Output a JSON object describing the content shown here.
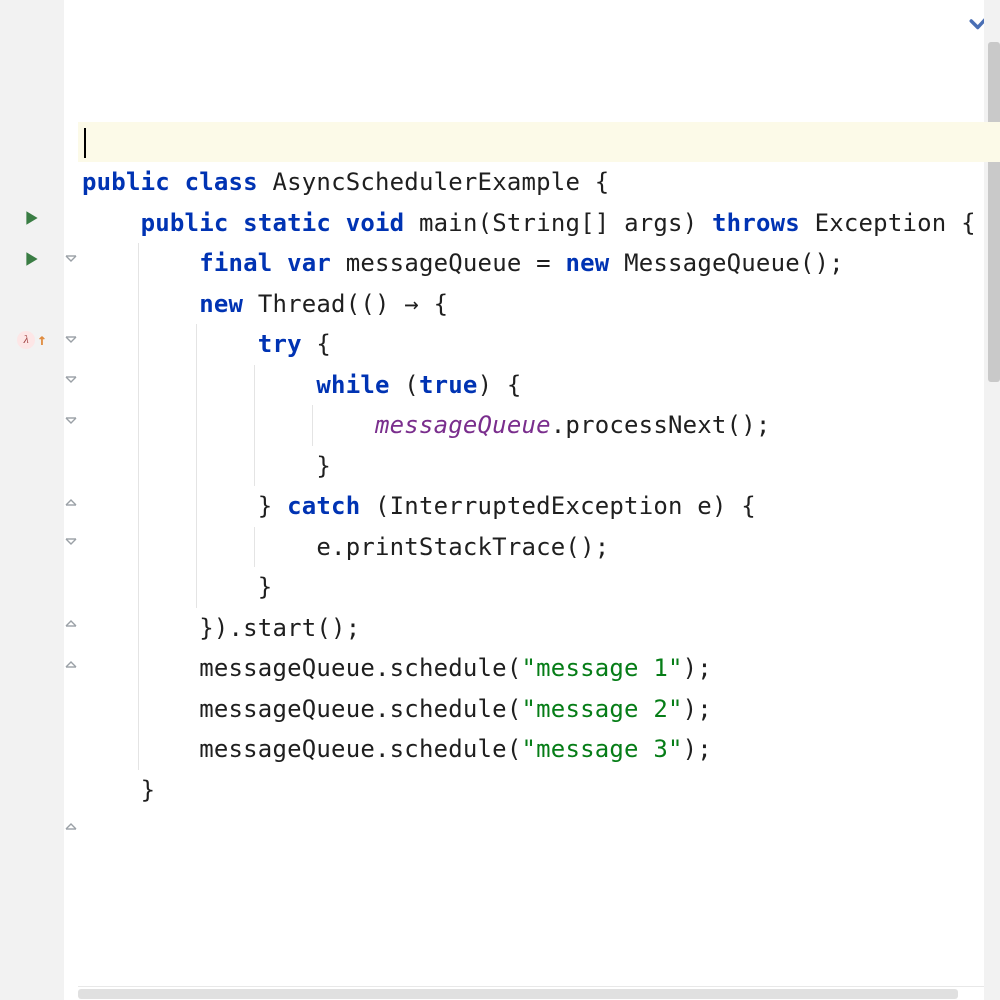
{
  "colors": {
    "keyword": "#0033B3",
    "string": "#067D17",
    "variable": "#7A2E8D",
    "highlight": "#fcfae8",
    "gutter": "#f2f2f2",
    "run": "#3a7d44",
    "fold": "#9aa0a6",
    "check": "#4a6fb5"
  },
  "code": {
    "line5": {
      "public": "public",
      "class": "class",
      "className": "AsyncSchedulerExample",
      "brace": "{"
    },
    "line6": {
      "public": "public",
      "static": "static",
      "void": "void",
      "method": "main",
      "params": "(String[] args)",
      "throws": "throws",
      "exc": "Exception",
      "brace": "{"
    },
    "line7": {
      "final": "final",
      "var": "var",
      "name": "messageQueue",
      "eq": " = ",
      "new": "new",
      "ctor": "MessageQueue()",
      "semi": ";"
    },
    "line8": {
      "new": "new",
      "thread": "Thread",
      "open": "((",
      "arrow": ") → {",
      "mid": ""
    },
    "line9": {
      "try": "try",
      "brace": " {"
    },
    "line10": {
      "while": "while",
      "open": " (",
      "true": "true",
      "close": ") {"
    },
    "line11": {
      "mq": "messageQueue",
      "call": ".processNext();"
    },
    "line12": {
      "close": "}"
    },
    "line13": {
      "closeTry": "} ",
      "catch": "catch",
      "rest": " (InterruptedException e) {"
    },
    "line14": {
      "body": "e.printStackTrace();"
    },
    "line15": {
      "close": "}"
    },
    "line16": {
      "close": "}).start();"
    },
    "line17": {
      "pre": "messageQueue.schedule(",
      "arg": "\"message 1\"",
      "post": ");"
    },
    "line18": {
      "pre": "messageQueue.schedule(",
      "arg": "\"message 2\"",
      "post": ");"
    },
    "line19": {
      "pre": "messageQueue.schedule(",
      "arg": "\"message 3\"",
      "post": ");"
    },
    "line20": {
      "close": "}"
    }
  },
  "icons": {
    "lambda": "λ"
  }
}
